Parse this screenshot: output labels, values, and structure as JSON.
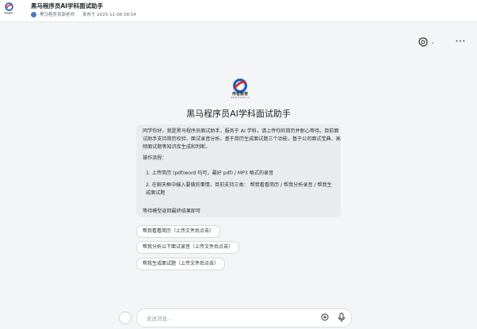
{
  "header": {
    "logo_text": "传智教育",
    "title": "黑马程序员AI学科面试助手",
    "author": "黑马程序员郭老师",
    "published": "发布于 2025-11-06 08:54"
  },
  "brand": {
    "name": "传智教育",
    "site": "www.itcast.cn"
  },
  "assistant_name": "黑马程序员AI学科面试助手",
  "message": {
    "intro": "同学你好，我是黑马程序员面试助手，服务于 AI 学科，请上传你的简历并耐心等待。目前面试助手支持简历校验、面试录音分析、基于简历生成面试题三个功能，基于公司面试宝典、高频面试题等知识库生成和判断。",
    "steps_title": "操作流程：",
    "step1": "1. 上传简历 (pdf/word 均可，最好 pdf) / MP3 格式的录音",
    "step2": "2. 在聊天框中输入要做的事情，目前支持三类： 帮我看看简历 / 帮我分析录音 / 帮我生成面试题",
    "footer": "等待模型返回最终结果即可"
  },
  "quick_replies": [
    "帮我看看简历（上传文件后点击）",
    "帮我分析以下面试录音（上传文件后点击）",
    "帮我生成面试题（上传文件后点击）"
  ],
  "input": {
    "placeholder": "发送消息..."
  },
  "icons": {
    "ai_settings": "ai-persona-icon",
    "more": "more-icon",
    "plus": "plus-circle-icon",
    "mic": "microphone-icon"
  }
}
